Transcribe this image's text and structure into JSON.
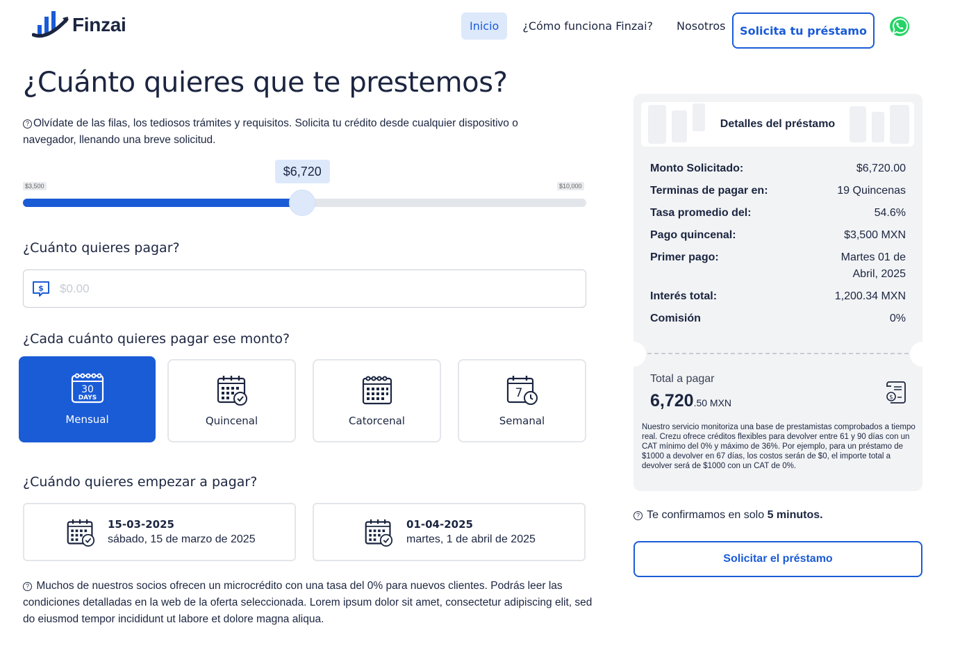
{
  "brand": {
    "name": "Finzai",
    "accent": "#1a5bd6",
    "whatsapp_color": "#25d366"
  },
  "nav": {
    "items": [
      {
        "label": "Inicio",
        "active": true
      },
      {
        "label": "¿Cómo funciona Finzai?",
        "active": false
      },
      {
        "label": "Nosotros",
        "active": false
      }
    ],
    "cta_label": "Solicita tu préstamo",
    "whatsapp_icon": "whatsapp-icon"
  },
  "hero": {
    "title": "¿Cuánto quieres que te prestemos?",
    "intro": "Olvídate de las filas, los tediosos trámites y requisitos. Solicita tu crédito desde cualquier dispositivo o navegador, llenando una breve solicitud."
  },
  "slider": {
    "value_label": "$6,720",
    "min_label": "$3,500",
    "max_label": "$10,000",
    "min": 3500,
    "max": 10000,
    "value": 6720
  },
  "payment": {
    "label": "¿Cuánto quieres pagar?",
    "placeholder": "$0.00",
    "value": ""
  },
  "frequency": {
    "label": "¿Cada cuánto quieres pagar ese monto?",
    "options": [
      {
        "label": "Mensual",
        "icon": "calendar-30-days-icon",
        "selected": true,
        "badge_top": "30",
        "badge_bottom": "DAYS"
      },
      {
        "label": "Quincenal",
        "icon": "calendar-check-icon",
        "selected": false
      },
      {
        "label": "Catorcenal",
        "icon": "calendar-grid-icon",
        "selected": false
      },
      {
        "label": "Semanal",
        "icon": "calendar-clock-icon",
        "selected": false,
        "badge_top": "7"
      }
    ]
  },
  "start": {
    "label": "¿Cuándo quieres empezar a pagar?",
    "options": [
      {
        "date": "15-03-2025",
        "long": "sábado, 15 de marzo de 2025"
      },
      {
        "date": "01-04-2025",
        "long": "martes, 1 de abril de 2025"
      }
    ]
  },
  "footer_note": "Muchos de nuestros socios ofrecen un microcrédito con una tasa del 0% para nuevos clientes. Podrás leer las condiciones detalladas en la web de la oferta seleccionada. Lorem ipsum dolor sit amet, consectetur adipiscing elit, sed do eiusmod tempor incididunt ut labore et dolore magna aliqua.",
  "details": {
    "title": "Detalles del préstamo",
    "rows": [
      {
        "key": "Monto Solicitado:",
        "value": "$6,720.00"
      },
      {
        "key": "Terminas de pagar en:",
        "value": "19 Quincenas"
      },
      {
        "key": "Tasa promedio del:",
        "value": "54.6%"
      },
      {
        "key": "Pago quincenal:",
        "value": "$3,500 MXN"
      },
      {
        "key": "Primer pago:",
        "value": "Martes 01 de Abril, 2025"
      },
      {
        "key": "Interés total:",
        "value": "1,200.34 MXN"
      },
      {
        "key": "Comisión",
        "value": "0%"
      }
    ],
    "total_label": "Total a pagar",
    "total_main": "6,720",
    "total_cents": ".50 MXN",
    "disclaimer": "Nuestro servicio monitoriza una base de prestamistas comprobados a tiempo real. Crezu ofrece créditos flexibles para devolver entre 61 y 90 días con un CAT mínimo del 0% y máximo de 36%. Por ejemplo, para un préstamo de $1000 a devolver en 67 días, los costos serán de $0, el importe total a devolver será de $1000 con un CAT de 0%."
  },
  "confirm": {
    "prefix": "Te confirmamos en solo",
    "bold": "5 minutos."
  },
  "submit_label": "Solicitar el préstamo"
}
